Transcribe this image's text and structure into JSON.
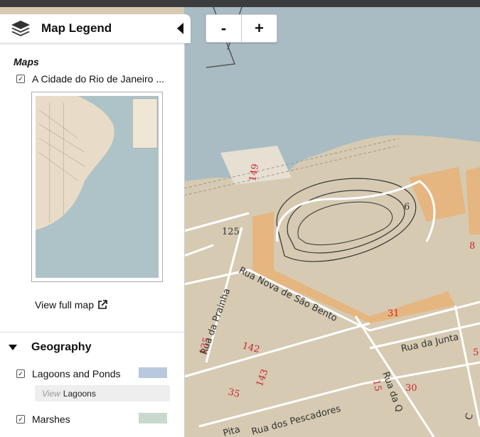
{
  "legend": {
    "title": "Map Legend",
    "maps_section": "Maps",
    "map_item": "A Cidade do Rio de Janeiro ...",
    "view_full_map": "View full map",
    "geography": {
      "title": "Geography",
      "layers": [
        {
          "label": "Lagoons and Ponds",
          "view_prefix": "View",
          "view_label": "Lagoons",
          "swatch": "#b8c9dd",
          "checked": true
        },
        {
          "label": "Marshes",
          "swatch": "#c9d9cc",
          "checked": true
        }
      ]
    }
  },
  "zoom": {
    "out_label": "-",
    "in_label": "+"
  },
  "map": {
    "labels": {
      "street_prainha": "Rua da Prainha",
      "street_sao_bento": "Rua Nova de São Bento",
      "street_junta": "Rua da Junta",
      "street_pescadores": "Rua dos Pescadores",
      "street_pita": "Pita",
      "street_q": "Rua da Q",
      "street_c": "C",
      "n149": "149",
      "n125": "125",
      "n142": "142",
      "n143": "143",
      "n135": "135",
      "n35": "35",
      "n30": "30",
      "n31": "31",
      "n15": "15",
      "n6": "6",
      "n8": "8",
      "n5": "5"
    }
  },
  "colors": {
    "water": "#a9bcc4",
    "land": "#d8ccb4",
    "building": "#e8b47a",
    "road": "#ffffff"
  }
}
